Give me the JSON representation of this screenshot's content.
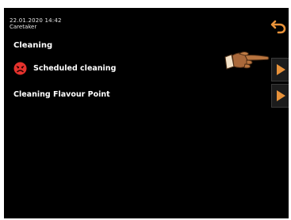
{
  "header": {
    "datetime": "22.01.2020 14:42",
    "role": "Caretaker",
    "back_icon": "back-arrow-icon"
  },
  "section": {
    "title": "Cleaning"
  },
  "menu": {
    "items": [
      {
        "label": "Scheduled cleaning",
        "status_icon": "sad-face-icon",
        "action_icon": "play-arrow-icon"
      },
      {
        "label": "Cleaning Flavour Point",
        "action_icon": "play-arrow-icon"
      }
    ]
  },
  "colors": {
    "background": "#000000",
    "accent_orange": "#e8923a",
    "warning_red": "#e5322d",
    "text": "#ffffff"
  }
}
